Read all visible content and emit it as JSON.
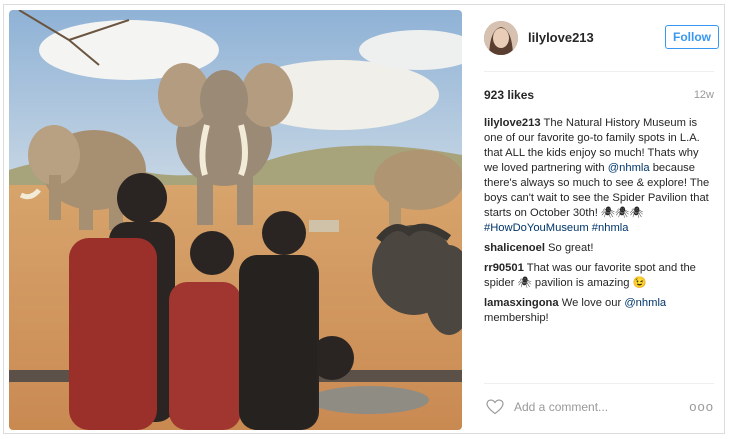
{
  "post": {
    "username": "lilylove213",
    "follow_label": "Follow",
    "likes": "923 likes",
    "age": "12w",
    "caption": {
      "user": "lilylove213",
      "text_1": "The Natural History Museum is one of our favorite go-to family spots in L.A. that ALL the kids enjoy so much! Thats why we loved partnering with",
      "mention": "@nhmla",
      "text_2": "because there's always so much to see & explore! The boys can't wait to see the Spider Pavilion that starts on October 30th!",
      "emojis": "🕷🕷🕷",
      "hashtags": "#HowDoYouMuseum #nhmla"
    },
    "comments": [
      {
        "user": "shalicenoel",
        "text": "So great!"
      },
      {
        "user": "rr90501",
        "text": "That was our favorite spot and the spider 🕷 pavilion is amazing 😉"
      },
      {
        "user": "lamasxingona",
        "text": "We love our",
        "mention": "@nhmla",
        "text_after": "membership!"
      }
    ],
    "add_comment_placeholder": "Add a comment...",
    "more_options": "ooo"
  },
  "icons": {
    "like": "heart-icon",
    "options": "more-options-icon"
  },
  "colors": {
    "accent": "#3897f0",
    "link": "#003569",
    "muted": "#999999"
  }
}
